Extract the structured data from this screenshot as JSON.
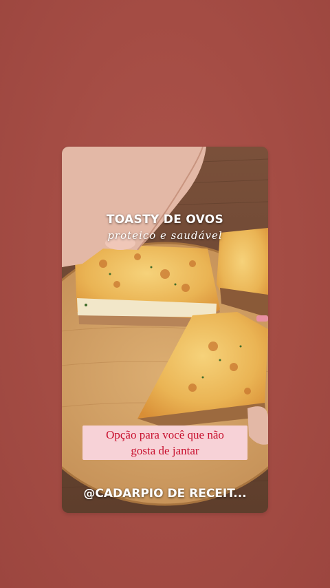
{
  "story": {
    "background_color": "#a64d45",
    "post": {
      "title": "TOASTY DE OVOS",
      "subtitle": "proteico e saudável",
      "caption_line1": "Opção para você que não",
      "caption_line2": "gosta de jantar",
      "caption_color": "#c8102e",
      "caption_background": "#f7d2d7",
      "mention": "@CADARPIO DE RECEIT..."
    }
  }
}
